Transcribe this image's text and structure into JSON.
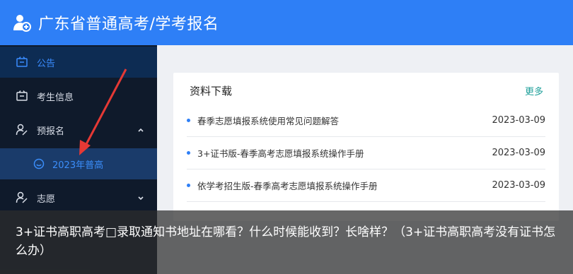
{
  "header": {
    "title": "广东省普通高考/学考报名"
  },
  "sidebar": {
    "items": [
      {
        "label": "公告"
      },
      {
        "label": "考生信息"
      },
      {
        "label": "预报名"
      },
      {
        "label": "2023年普高"
      },
      {
        "label": "志愿"
      }
    ]
  },
  "card": {
    "title": "资料下载",
    "more": "更多",
    "rows": [
      {
        "text": "春季志愿填报系统使用常见问题解答",
        "date": "2023-03-09"
      },
      {
        "text": "3+证书版-春季高考志愿填报系统操作手册",
        "date": "2023-03-09"
      },
      {
        "text": "依学考招生版-春季高考志愿填报系统操作手册",
        "date": "2023-03-09"
      }
    ]
  },
  "overlay": {
    "caption": "3+证书高职高考□录取通知书地址在哪看？什么时候能收到？长啥样？（3+证书高职高考没有证书怎么办）"
  },
  "colors": {
    "header": "#2e7ff6",
    "sidebar": "#0f1a2b",
    "active": "#3a8cff",
    "more": "#1e9f9a",
    "arrow": "#e53935"
  }
}
